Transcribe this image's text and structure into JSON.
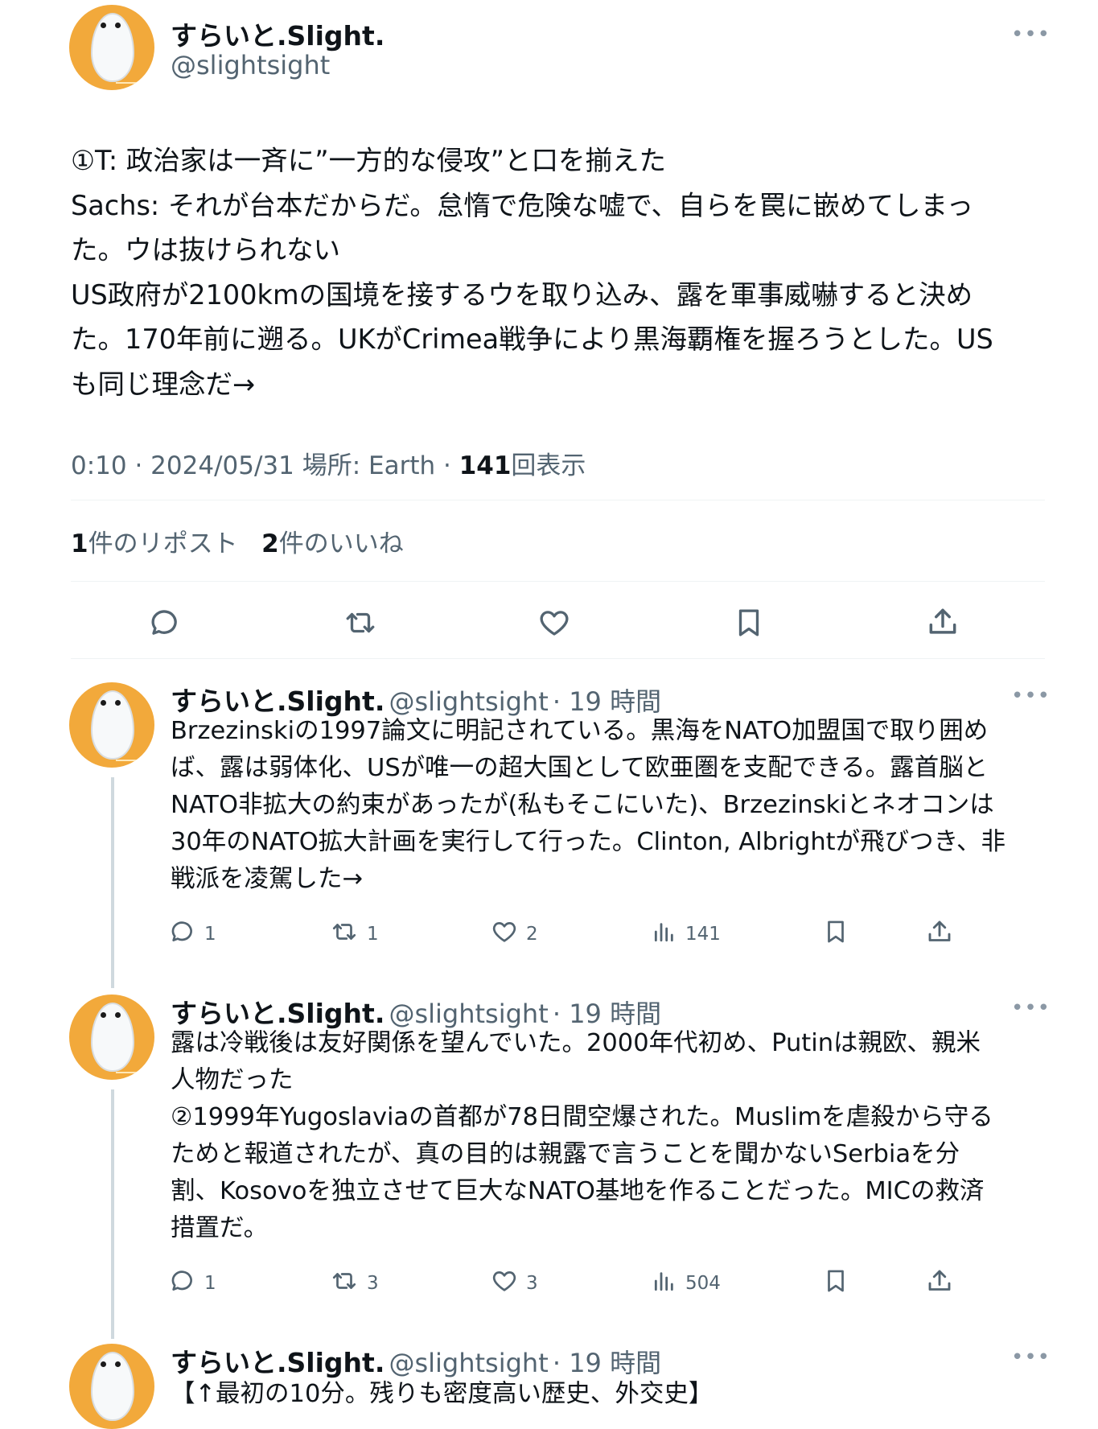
{
  "main_tweet": {
    "name": "すらいと.Slight.",
    "handle": "@slightsight",
    "lines": [
      "①T: 政治家は一斉に”一方的な侵攻”と口を揃えた",
      "Sachs: それが台本だからだ。怠惰で危険な嘘で、自らを罠に嵌めてしまっ",
      "た。ウは抜けられない",
      "US政府が2100kmの国境を接するウを取り込み、露を軍事威嚇すると決め",
      "た。170年前に遡る。UKがCrimea戦争により黒海覇権を握ろうとした。US",
      "も同じ理念だ→"
    ],
    "meta_time": "0:10 · 2024/05/31 場所: Earth · ",
    "meta_views_count": "141",
    "meta_views_label": "回表示",
    "reposts_count": "1",
    "reposts_label": "件のリポスト",
    "likes_count": "2",
    "likes_label": "件のいいね"
  },
  "icons": {
    "reply": "reply-icon",
    "repost": "repost-icon",
    "like": "heart-icon",
    "bookmark": "bookmark-icon",
    "share": "share-icon",
    "views": "views-icon",
    "more": "more-icon"
  },
  "replies": [
    {
      "name": "すらいと.Slight.",
      "handle": "@slightsight",
      "time": "· 19 時間",
      "lines": [
        "Brzezinskiの1997論文に明記されている。黒海をNATO加盟国で取り囲め",
        "ば、露は弱体化、USが唯一の超大国として欧亜圏を支配できる。露首脳と",
        "NATO非拡大の約束があったが(私もそこにいた)、Brzezinskiとネオコンは",
        "30年のNATO拡大計画を実行して行った。Clinton, Albrightが飛びつき、非",
        "戦派を凌駕した→"
      ],
      "replies": "1",
      "reposts": "1",
      "likes": "2",
      "views": "141"
    },
    {
      "name": "すらいと.Slight.",
      "handle": "@slightsight",
      "time": "· 19 時間",
      "lines": [
        "露は冷戦後は友好関係を望んでいた。2000年代初め、Putinは親欧、親米",
        "人物だった",
        "②1999年Yugoslaviaの首都が78日間空爆された。Muslimを虐殺から守る",
        "ためと報道されたが、真の目的は親露で言うことを聞かないSerbiaを分",
        "割、Kosovoを独立させて巨大なNATO基地を作ることだった。MICの救済",
        "措置だ。"
      ],
      "replies": "1",
      "reposts": "3",
      "likes": "3",
      "views": "504"
    },
    {
      "name": "すらいと.Slight.",
      "handle": "@slightsight",
      "time": "· 19 時間",
      "lines": [
        "【↑最初の10分。残りも密度高い歴史、外交史】"
      ]
    }
  ]
}
